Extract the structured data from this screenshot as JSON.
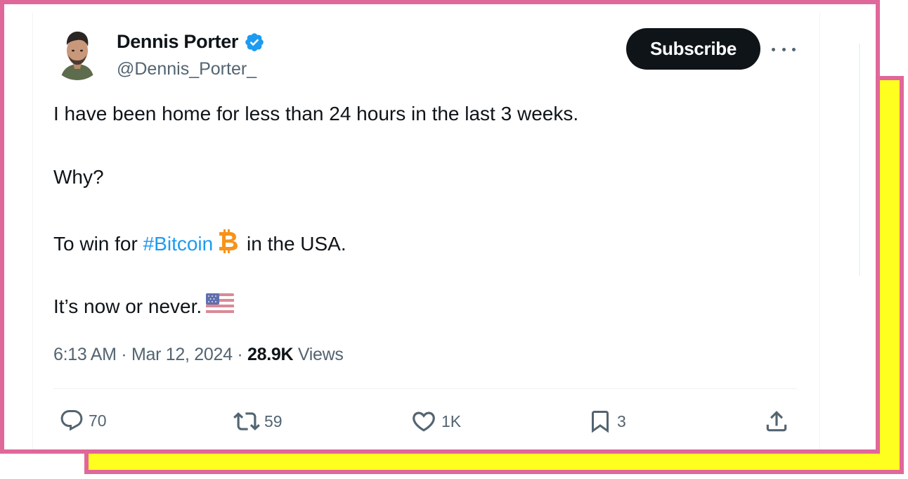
{
  "author": {
    "display_name": "Dennis Porter",
    "handle": "@Dennis_Porter_",
    "verified": true
  },
  "subscribe_label": "Subscribe",
  "tweet": {
    "line1": "I have been home for less than 24 hours in the last 3 weeks.",
    "line2": "Why?",
    "line3_prefix": "To win for ",
    "line3_hashtag": "#Bitcoin",
    "line3_suffix": " in the USA.",
    "line4": "It’s now or never."
  },
  "meta": {
    "time": "6:13 AM",
    "separator1": " · ",
    "date": "Mar 12, 2024",
    "separator2": " · ",
    "views_count": "28.9K",
    "views_label": " Views"
  },
  "actions": {
    "replies": "70",
    "reposts": "59",
    "likes": "1K",
    "bookmarks": "3"
  },
  "icons": {
    "verified": "verified-badge-icon",
    "bitcoin": "bitcoin-emoji",
    "flag": "us-flag-emoji",
    "more": "more-horizontal-icon",
    "reply": "reply-icon",
    "repost": "repost-icon",
    "like": "heart-icon",
    "bookmark": "bookmark-icon",
    "share": "share-icon"
  },
  "colors": {
    "border": "#e0679a",
    "highlight": "#ffff1f",
    "text": "#0f1419",
    "secondary": "#536471",
    "link": "#1d9bf0",
    "verified": "#1d9bf0",
    "bitcoin": "#f7931a"
  }
}
